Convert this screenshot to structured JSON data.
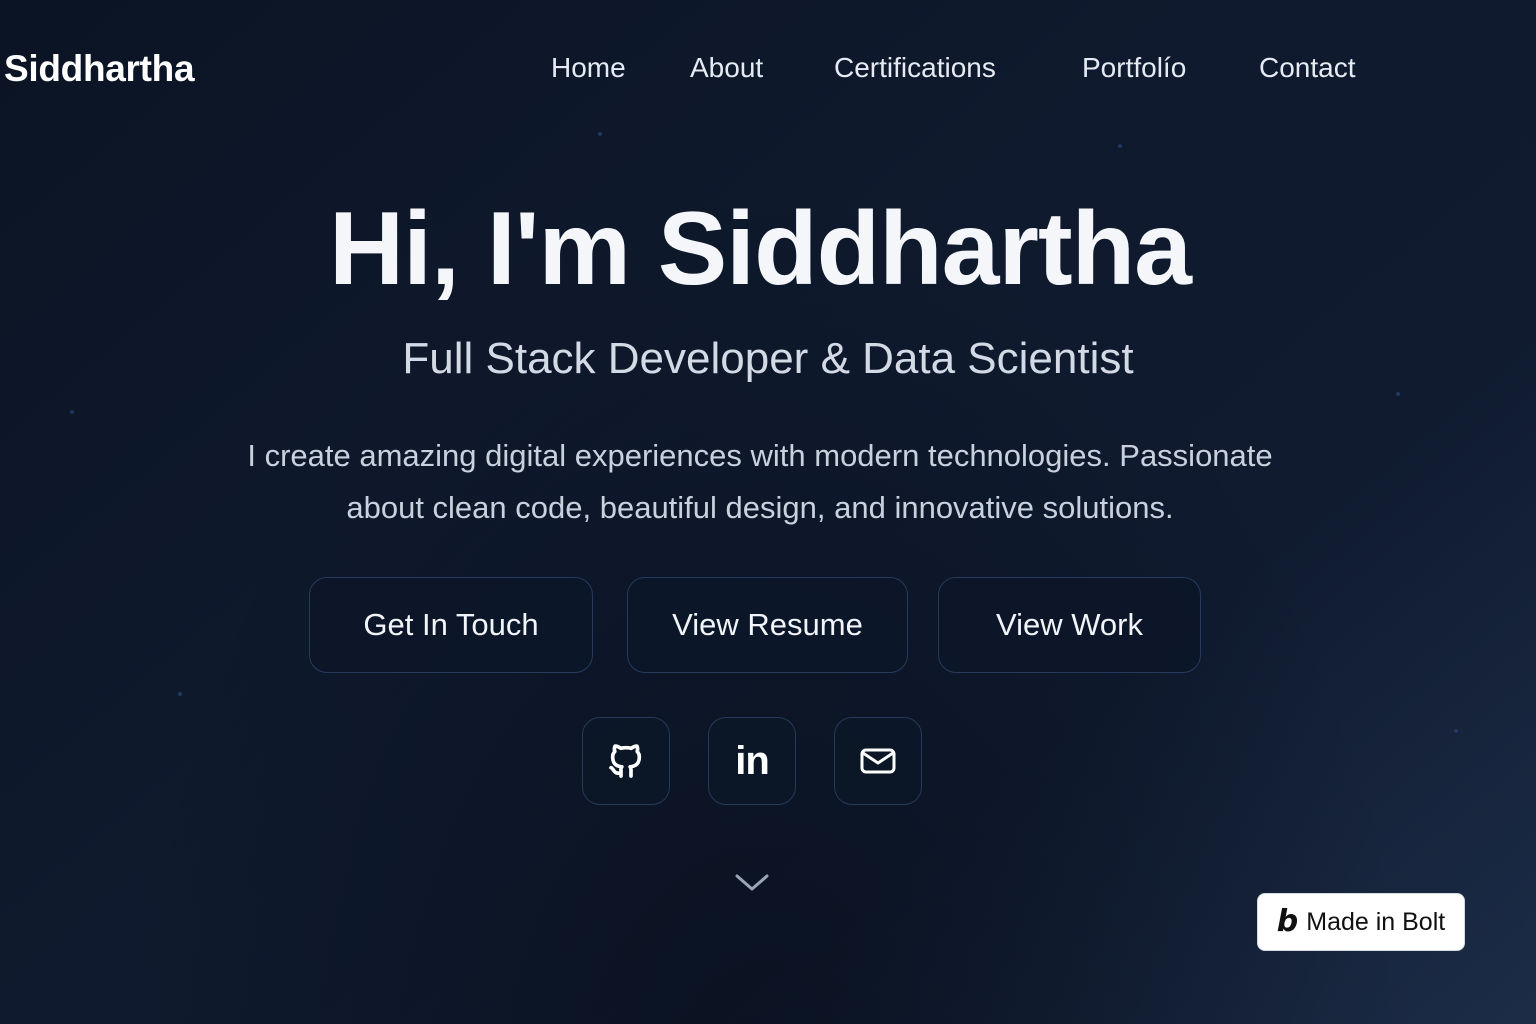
{
  "brand": {
    "name": "Siddhartha"
  },
  "nav": {
    "items": [
      {
        "label": "Home"
      },
      {
        "label": "About"
      },
      {
        "label": "Certifications"
      },
      {
        "label": "Portfolío"
      },
      {
        "label": "Contact"
      }
    ]
  },
  "hero": {
    "title": "Hi, I'm Siddhartha",
    "subtitle": "Full Stack Developer & Data Scientist",
    "description_line1": "I create amazing digital experiences with modern technologies. Passionate",
    "description_line2": "about clean code, beautiful design, and innovative solutions."
  },
  "actions": {
    "get_in_touch": "Get In Touch",
    "view_resume": "View Resume",
    "view_work": "View Work"
  },
  "social": {
    "icons": [
      "github-icon",
      "linkedin-icon",
      "mail-icon"
    ],
    "linkedin_glyph": "in"
  },
  "badge": {
    "logo": "b",
    "label": "Made in Bolt"
  },
  "colors": {
    "background_start": "#0b1424",
    "background_end": "#1c2c47",
    "button_border": "#263a5c",
    "text_primary": "#f4f6fa"
  }
}
